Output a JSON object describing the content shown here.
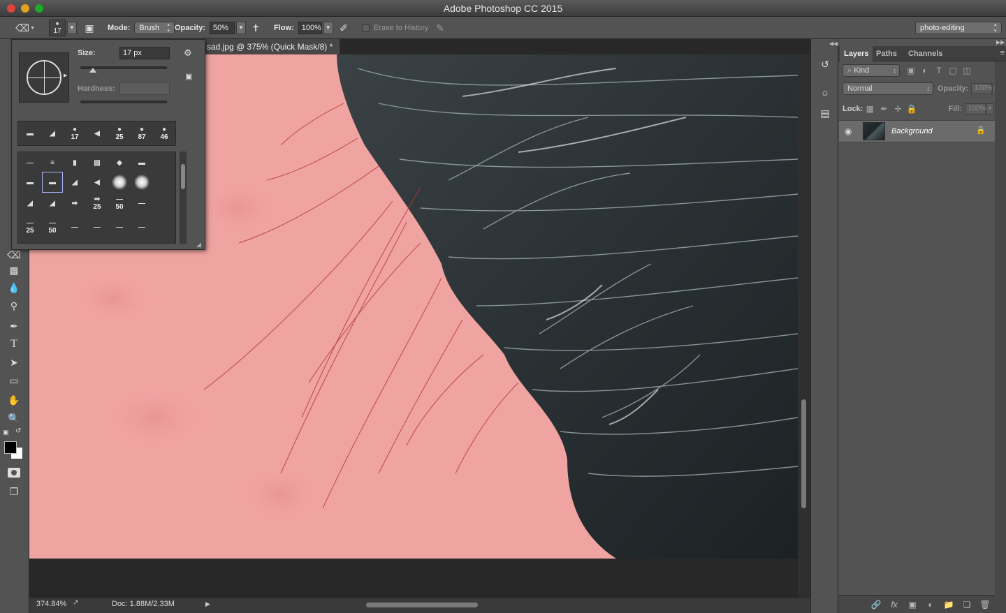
{
  "window": {
    "title": "Adobe Photoshop CC 2015"
  },
  "options_bar": {
    "brush_size": "17",
    "mode_label": "Mode:",
    "mode_value": "Brush",
    "opacity_label": "Opacity:",
    "opacity_value": "50%",
    "flow_label": "Flow:",
    "flow_value": "100%",
    "erase_history_label": "Erase to History",
    "workspace": "photo-editing",
    "icons": [
      "eraser-icon",
      "brush-panel-toggle-icon",
      "airbrush-icon",
      "pressure-opacity-icon",
      "pressure-size-icon"
    ]
  },
  "document": {
    "tab_title": "sad.jpg @ 375% (Quick Mask/8) *",
    "zoom": "374.84%",
    "doc_size": "Doc: 1.88M/2.33M"
  },
  "brush_picker": {
    "size_label": "Size:",
    "size_value": "17 px",
    "hardness_label": "Hardness:",
    "hardness_value": "",
    "recent_tips": [
      {
        "shape": "▬",
        "num": ""
      },
      {
        "shape": "◢",
        "num": ""
      },
      {
        "shape": "●",
        "num": "17"
      },
      {
        "shape": "◀",
        "num": ""
      },
      {
        "shape": "●",
        "num": "25"
      },
      {
        "shape": "●",
        "num": "87"
      },
      {
        "shape": "●",
        "num": "46"
      }
    ],
    "grid_rows": [
      [
        {
          "shape": "—",
          "num": ""
        },
        {
          "shape": "≡",
          "num": ""
        },
        {
          "shape": "▮",
          "num": ""
        },
        {
          "shape": "▧",
          "num": ""
        },
        {
          "shape": "◆",
          "num": ""
        },
        {
          "shape": "▬",
          "num": ""
        }
      ],
      [
        {
          "shape": "▬",
          "num": ""
        },
        {
          "shape": "▬",
          "num": ""
        },
        {
          "shape": "◢",
          "num": ""
        },
        {
          "shape": "◀",
          "num": ""
        },
        {
          "shape": "soft",
          "num": ""
        },
        {
          "shape": "soft",
          "num": ""
        }
      ],
      [
        {
          "shape": "◢",
          "num": ""
        },
        {
          "shape": "◢",
          "num": ""
        },
        {
          "shape": "➡",
          "num": ""
        },
        {
          "shape": "➡",
          "num": "25"
        },
        {
          "shape": "—",
          "num": "50"
        },
        {
          "shape": "—",
          "num": ""
        }
      ],
      [
        {
          "shape": "—",
          "num": "25"
        },
        {
          "shape": "—",
          "num": "50"
        },
        {
          "shape": "—",
          "num": ""
        },
        {
          "shape": "—",
          "num": ""
        },
        {
          "shape": "—",
          "num": ""
        },
        {
          "shape": "—",
          "num": ""
        }
      ]
    ]
  },
  "layers_panel": {
    "tabs": [
      "Layers",
      "Paths",
      "Channels"
    ],
    "filter_kind": "Kind",
    "blend_mode": "Normal",
    "opacity_label": "Opacity:",
    "opacity_value": "100%",
    "lock_label": "Lock:",
    "fill_label": "Fill:",
    "fill_value": "100%",
    "layers": [
      {
        "name": "Background",
        "visible": true,
        "locked": true
      }
    ]
  },
  "colors": {
    "quick_mask": "#f0a4a2",
    "panel_bg": "#535353",
    "dark_bg": "#282828",
    "foreground": "#000000",
    "background": "#ffffff"
  }
}
